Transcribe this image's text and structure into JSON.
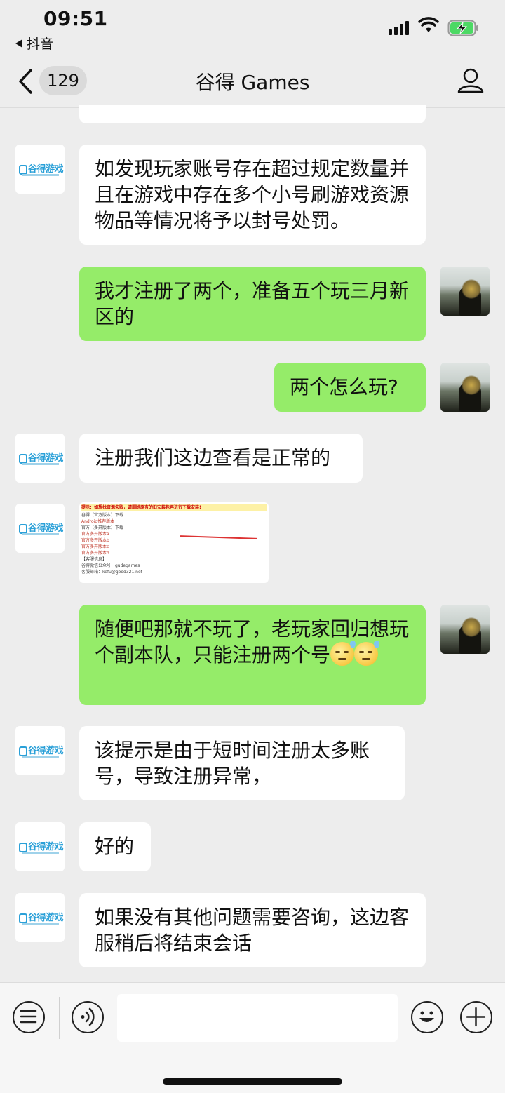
{
  "status_bar": {
    "time": "09:51",
    "back_app": "抖音",
    "icons": [
      "cellular-signal-icon",
      "wifi-icon",
      "battery-charging-icon"
    ]
  },
  "nav": {
    "unread_count": "129",
    "title": "谷得 Games",
    "icons": [
      "back-chevron-icon",
      "user-profile-icon"
    ]
  },
  "service_logo_text": "谷得游戏",
  "messages": [
    {
      "side": "in",
      "text": "如发现玩家账号存在超过规定数量并且在游戏中存在多个小号刷游戏资源物品等情况将予以封号处罚。"
    },
    {
      "side": "out",
      "text": "我才注册了两个，准备五个玩三月新区的"
    },
    {
      "side": "out",
      "text": "两个怎么玩?"
    },
    {
      "side": "in",
      "text": "注册我们这边查看是正常的"
    },
    {
      "side": "in",
      "type": "image"
    },
    {
      "side": "out",
      "text": "随便吧那就不玩了，老玩家回归想玩个副本队，只能注册两个号"
    },
    {
      "side": "in",
      "text": "该提示是由于短时间注册太多账号，导致注册异常，"
    },
    {
      "side": "in",
      "text": "好的"
    },
    {
      "side": "in",
      "text": "如果没有其他问题需要咨询，这边客服稍后将结束会话"
    }
  ],
  "image_message": {
    "lines": [
      "提示：如想找资源失败，请删除原有的旧安装包再进行下载安装!",
      "谷得（官方版本）下载",
      "Android推荐版本",
      "官方（多开版本）下载",
      "官方多开版本a",
      "官方多开版本b",
      "官方多开版本c",
      "官方多开版本d",
      "【客服信息】",
      "谷得微信公众号：gudegames",
      "客服邮箱：kefu@good321.net"
    ]
  },
  "input_bar": {
    "icons": [
      "message-list-icon",
      "voice-icon",
      "emoji-icon",
      "plus-icon"
    ]
  }
}
